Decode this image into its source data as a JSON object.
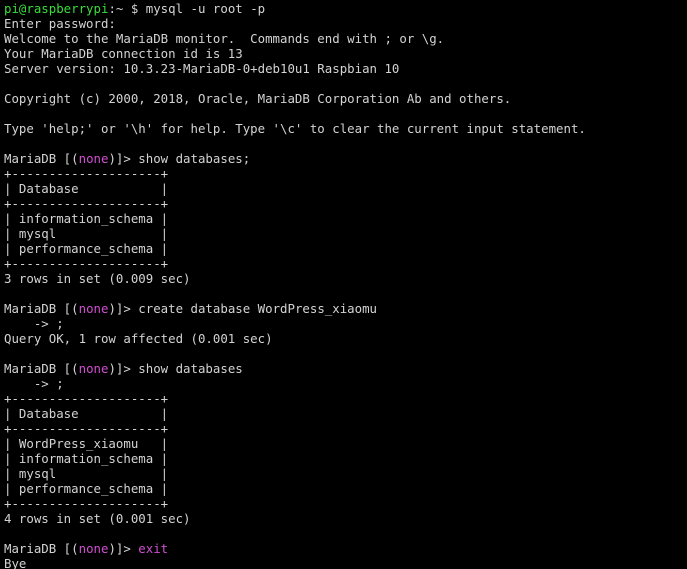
{
  "colors": {
    "background": "#000000",
    "text": "#d3d3d3",
    "prompt_user_host": "#3cdc3c",
    "highlight": "#d04fd0"
  },
  "shell_prompt": {
    "user_host": "pi@raspberrypi",
    "path": ":~",
    "symbol": " $ ",
    "command": "mysql",
    "args": " -u root -p"
  },
  "lines": [
    "Enter password:",
    "Welcome to the MariaDB monitor.  Commands end with ; or \\g.",
    "Your MariaDB connection id is 13",
    "Server version: 10.3.23-MariaDB-0+deb10u1 Raspbian 10",
    "",
    "Copyright (c) 2000, 2018, Oracle, MariaDB Corporation Ab and others.",
    "",
    "Type 'help;' or '\\h' for help. Type '\\c' to clear the current input statement.",
    ""
  ],
  "mysql_prompt": {
    "prefix": "MariaDB [(",
    "db": "none",
    "suffix": ")]> "
  },
  "session": {
    "cmd1": "show databases;",
    "table1": [
      "+--------------------+",
      "| Database           |",
      "+--------------------+",
      "| information_schema |",
      "| mysql              |",
      "| performance_schema |",
      "+--------------------+"
    ],
    "result1": "3 rows in set (0.009 sec)",
    "cmd2": "create database WordPress_xiaomu",
    "cont2": "    -> ;",
    "result2": "Query OK, 1 row affected (0.001 sec)",
    "cmd3": "show databases",
    "cont3": "    -> ;",
    "table3": [
      "+--------------------+",
      "| Database           |",
      "+--------------------+",
      "| WordPress_xiaomu   |",
      "| information_schema |",
      "| mysql              |",
      "| performance_schema |",
      "+--------------------+"
    ],
    "result3": "4 rows in set (0.001 sec)",
    "cmd4": "exit",
    "bye": "Bye"
  }
}
